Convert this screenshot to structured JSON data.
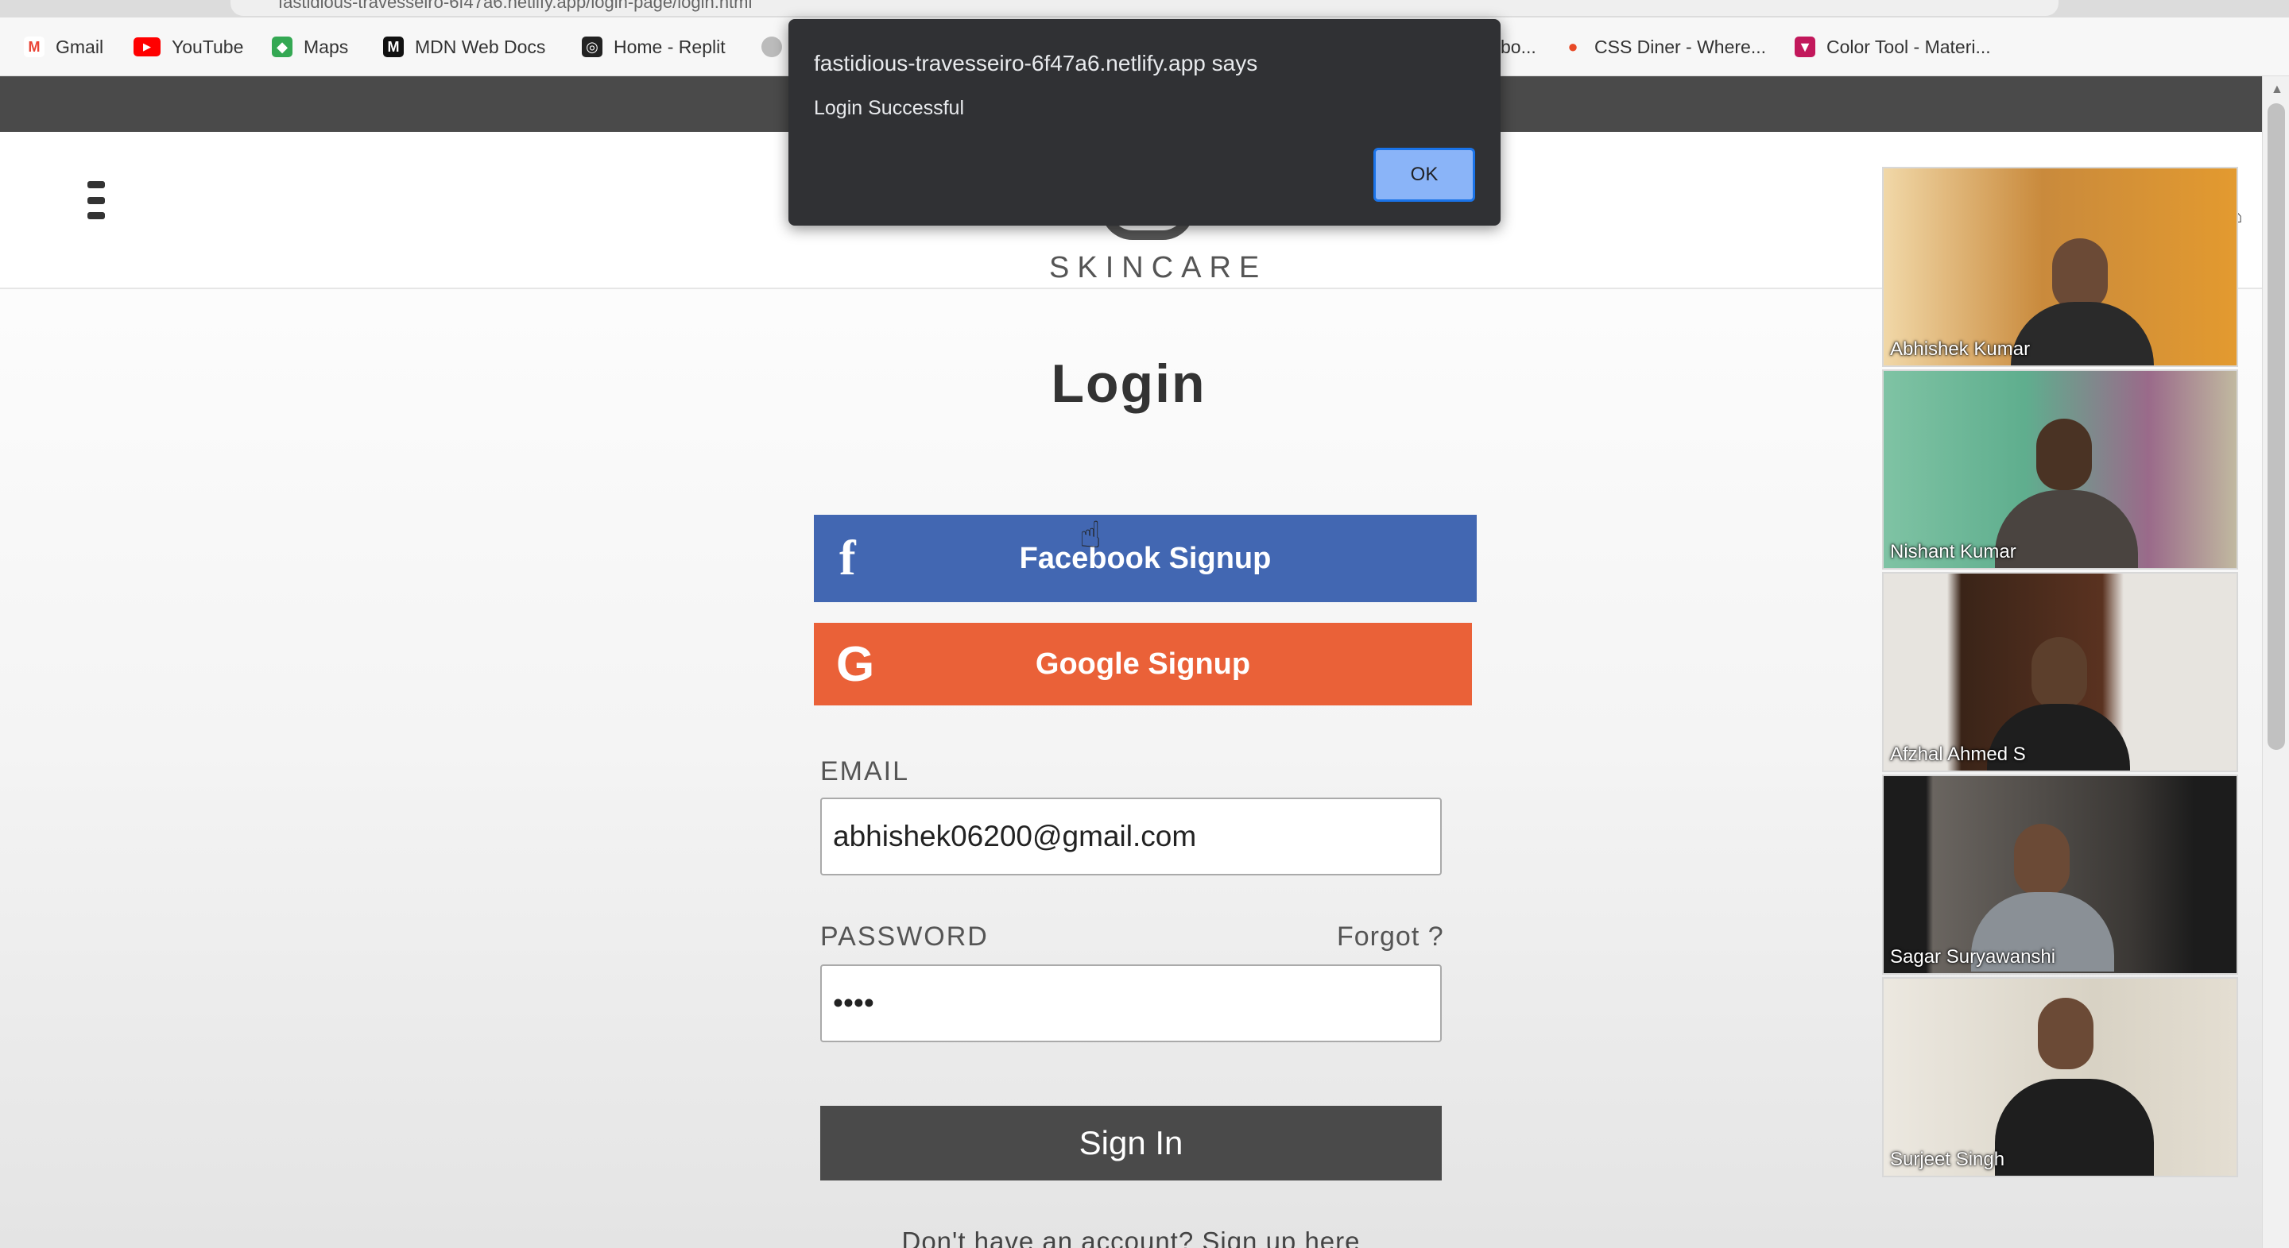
{
  "browser": {
    "url": "fastidious-travesseiro-6f47a6.netlify.app/login-page/login.html",
    "bookmarks": [
      {
        "label": "Gmail",
        "icon": "gmail-icon",
        "glyph": "M",
        "color": "#ea4335"
      },
      {
        "label": "YouTube",
        "icon": "youtube-icon",
        "glyph": "▶",
        "color": "#ff0000"
      },
      {
        "label": "Maps",
        "icon": "maps-icon",
        "glyph": "◆",
        "color": "#34a853"
      },
      {
        "label": "MDN Web Docs",
        "icon": "mdn-icon",
        "glyph": "M",
        "color": "#111111"
      },
      {
        "label": "Home - Replit",
        "icon": "replit-icon",
        "glyph": "◎",
        "color": "#222222"
      },
      {
        "label": "bo...",
        "icon": "globe-icon",
        "glyph": "",
        "color": "#999999"
      },
      {
        "label": "CSS Diner - Where...",
        "icon": "css-diner-icon",
        "glyph": "●",
        "color": "#e84a27"
      },
      {
        "label": "Color Tool - Materi...",
        "icon": "color-tool-icon",
        "glyph": "▼",
        "color": "#c2185b"
      }
    ]
  },
  "site": {
    "logo_text": "SKINCARE",
    "login_title": "Login",
    "facebook_label": "Facebook Signup",
    "google_label": "Google Signup",
    "email_label": "EMAIL",
    "email_value": "abhishek06200@gmail.com",
    "password_label": "PASSWORD",
    "forgot_label": "Forgot ?",
    "password_value": "••••",
    "signin_label": "Sign In",
    "signup_text": "Don't have an account? Sign up here"
  },
  "dialog": {
    "title": "fastidious-travesseiro-6f47a6.netlify.app says",
    "message": "Login Successful",
    "ok_label": "OK"
  },
  "participants": [
    {
      "name": "Abhishek Kumar",
      "bg": "#c98a3c"
    },
    {
      "name": "Nishant Kumar",
      "bg": "#5fae8e"
    },
    {
      "name": "Afzhal Ahmed S",
      "bg": "#3a2418"
    },
    {
      "name": "Sagar Suryawanshi",
      "bg": "#5a554f"
    },
    {
      "name": "Surjeet Singh",
      "bg": "#d8d2c4"
    }
  ],
  "colors": {
    "facebook": "#4267b2",
    "google": "#ea6138",
    "signin": "#4a4a4a",
    "dialog_bg": "#303134",
    "dialog_ok": "#8ab4f8"
  }
}
